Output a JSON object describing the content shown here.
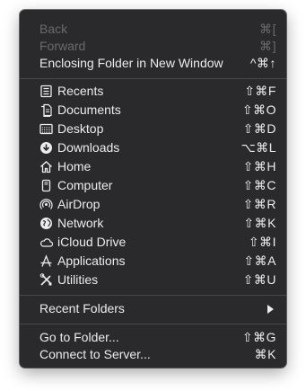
{
  "menu": {
    "back": {
      "label": "Back",
      "shortcut": "⌘["
    },
    "forward": {
      "label": "Forward",
      "shortcut": "⌘]"
    },
    "enclosing": {
      "label": "Enclosing Folder in New Window",
      "shortcut": "^⌘↑"
    },
    "places": [
      {
        "key": "recents",
        "icon": "recents-icon",
        "label": "Recents",
        "shortcut": "⇧⌘F"
      },
      {
        "key": "documents",
        "icon": "documents-icon",
        "label": "Documents",
        "shortcut": "⇧⌘O"
      },
      {
        "key": "desktop",
        "icon": "desktop-icon",
        "label": "Desktop",
        "shortcut": "⇧⌘D"
      },
      {
        "key": "downloads",
        "icon": "downloads-icon",
        "label": "Downloads",
        "shortcut": "⌥⌘L"
      },
      {
        "key": "home",
        "icon": "home-icon",
        "label": "Home",
        "shortcut": "⇧⌘H"
      },
      {
        "key": "computer",
        "icon": "computer-icon",
        "label": "Computer",
        "shortcut": "⇧⌘C"
      },
      {
        "key": "airdrop",
        "icon": "airdrop-icon",
        "label": "AirDrop",
        "shortcut": "⇧⌘R"
      },
      {
        "key": "network",
        "icon": "network-icon",
        "label": "Network",
        "shortcut": "⇧⌘K"
      },
      {
        "key": "icloud",
        "icon": "icloud-icon",
        "label": "iCloud Drive",
        "shortcut": "⇧⌘I"
      },
      {
        "key": "applications",
        "icon": "applications-icon",
        "label": "Applications",
        "shortcut": "⇧⌘A"
      },
      {
        "key": "utilities",
        "icon": "utilities-icon",
        "label": "Utilities",
        "shortcut": "⇧⌘U"
      }
    ],
    "recent_folders": {
      "label": "Recent Folders"
    },
    "go_to_folder": {
      "label": "Go to Folder...",
      "shortcut": "⇧⌘G"
    },
    "connect_server": {
      "label": "Connect to Server...",
      "shortcut": "⌘K"
    }
  }
}
